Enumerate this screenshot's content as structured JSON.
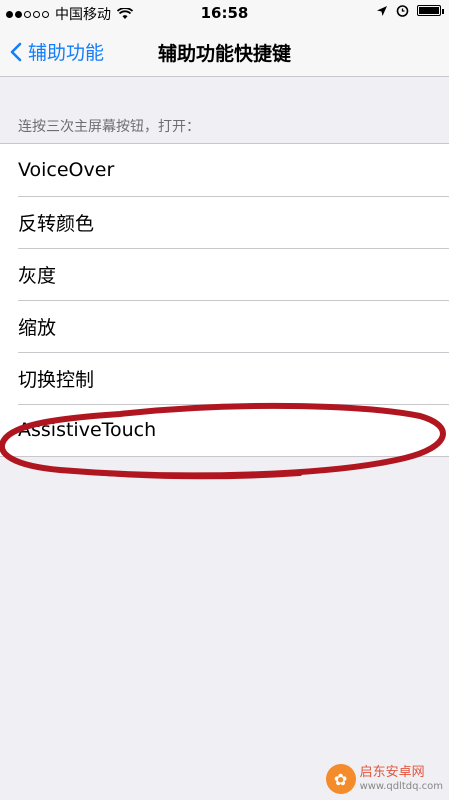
{
  "status_bar": {
    "carrier": "中国移动",
    "time": "16:58"
  },
  "nav": {
    "back_label": "辅助功能",
    "title": "辅助功能快捷键"
  },
  "section": {
    "header": "连按三次主屏幕按钮，打开："
  },
  "items": [
    {
      "label": "VoiceOver"
    },
    {
      "label": "反转颜色"
    },
    {
      "label": "灰度"
    },
    {
      "label": "缩放"
    },
    {
      "label": "切换控制"
    },
    {
      "label": "AssistiveTouch"
    }
  ],
  "watermark": {
    "text": "启东安卓网",
    "url": "www.qdltdq.com"
  },
  "colors": {
    "accent": "#147efb",
    "annotation": "#b0161f"
  }
}
